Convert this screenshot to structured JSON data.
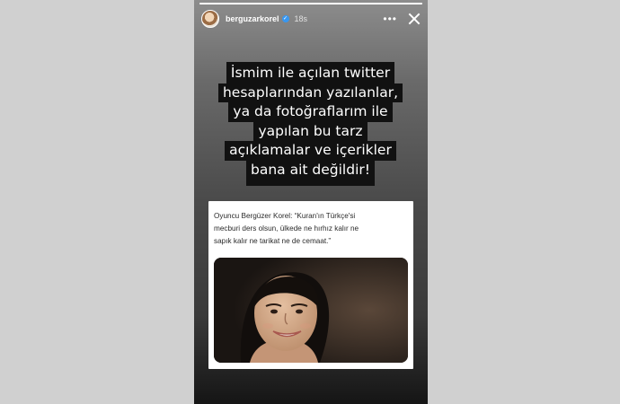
{
  "story": {
    "progress": 1.0,
    "username": "berguzarkorel",
    "verified_icon": "verified-check-icon",
    "time": "18s",
    "more_icon": "more-horizontal-icon",
    "close_icon": "close-icon"
  },
  "statement": {
    "lines": [
      "İsmim ile açılan twitter",
      "hesaplarından yazılanlar,",
      "ya da fotoğraflarım ile",
      "yapılan bu tarz",
      "açıklamalar ve içerikler",
      "bana ait değildir!"
    ]
  },
  "card": {
    "quote_lines": [
      "Oyuncu Bergüzer Korel: “Kuran'ın Türkçe'si",
      "mecburi ders olsun, ülkede ne hırhız kalır ne",
      "sapık kalır ne tarikat ne de cemaat.”"
    ]
  },
  "colors": {
    "verified": "#3897f0",
    "text_background": "#111111",
    "card_background": "#ffffff"
  }
}
